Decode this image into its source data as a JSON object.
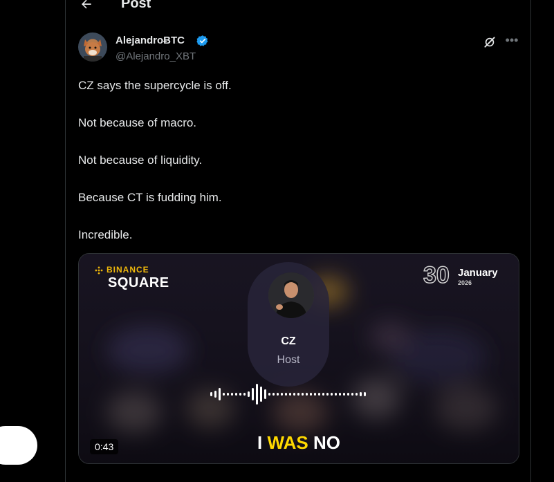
{
  "header": {
    "title": "Post"
  },
  "author": {
    "name": "AlejandroɃTC",
    "handle": "@Alejandro_XBT"
  },
  "tweet": {
    "lines": [
      "CZ says the supercycle is off.",
      "Not because of macro.",
      "Not because of liquidity.",
      "Because CT is fudding him.",
      "Incredible."
    ]
  },
  "media": {
    "brand_top": "BINANCE",
    "brand_bottom": "SQUARE",
    "date_day": "30",
    "date_month": "January",
    "date_year": "2026",
    "host_name": "CZ",
    "host_role": "Host",
    "duration": "0:43",
    "caption_a": "I",
    "caption_highlight": "WAS",
    "caption_b": "NO"
  },
  "colors": {
    "accent": "#1d9bf0",
    "caption_highlight": "#ffd900",
    "binance": "#f0b90b"
  },
  "icons": {
    "back": "arrow-left-icon",
    "verified": "verified-badge-icon",
    "grok": "grok-icon",
    "more": "more-icon"
  }
}
